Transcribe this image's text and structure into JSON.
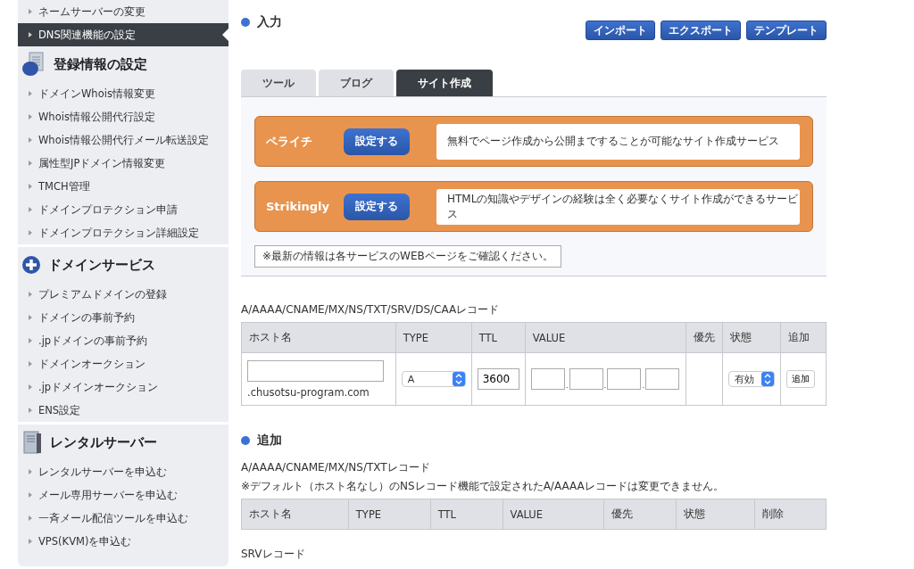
{
  "sidebar": {
    "items": [
      {
        "label": "ネームサーバーの変更",
        "selected": false
      },
      {
        "label": "DNS関連機能の設定",
        "selected": true
      }
    ],
    "sections": [
      {
        "kind": "records",
        "title": "登録情報の設定",
        "items": [
          {
            "label": "ドメインWhois情報変更",
            "selected": false
          },
          {
            "label": "Whois情報公開代行設定",
            "selected": false
          },
          {
            "label": "Whois情報公開代行メール転送設定",
            "selected": false
          },
          {
            "label": "属性型JPドメイン情報変更",
            "selected": false
          },
          {
            "label": "TMCH管理",
            "selected": false
          },
          {
            "label": "ドメインプロテクション申請",
            "selected": false
          },
          {
            "label": "ドメインプロテクション詳細設定",
            "selected": false
          }
        ]
      },
      {
        "kind": "service",
        "title": "ドメインサービス",
        "items": [
          {
            "label": "プレミアムドメインの登録",
            "selected": false
          },
          {
            "label": "ドメインの事前予約",
            "selected": false
          },
          {
            "label": ".jpドメインの事前予約",
            "selected": false
          },
          {
            "label": "ドメインオークション",
            "selected": false
          },
          {
            "label": ".jpドメインオークション",
            "selected": false
          },
          {
            "label": "ENS設定",
            "selected": false
          }
        ]
      },
      {
        "kind": "server",
        "title": "レンタルサーバー",
        "items": [
          {
            "label": "レンタルサーバーを申込む",
            "selected": false
          },
          {
            "label": "メール専用サーバーを申込む",
            "selected": false
          },
          {
            "label": "一斉メール配信ツールを申込む",
            "selected": false
          },
          {
            "label": "VPS(KVM)を申込む",
            "selected": false
          }
        ]
      }
    ]
  },
  "input": {
    "heading": "入力",
    "actions": [
      "インポート",
      "エクスポート",
      "テンプレート"
    ],
    "tabs": [
      {
        "label": "ツール",
        "selected": false
      },
      {
        "label": "ブログ",
        "selected": false
      },
      {
        "label": "サイト作成",
        "selected": true
      }
    ],
    "services": [
      {
        "name": "ペライチ",
        "button": "設定する",
        "description": "無料でページ作成から公開まですることが可能なサイト作成サービス"
      },
      {
        "name": "Strikingly",
        "button": "設定する",
        "description": "HTMLの知識やデザインの経験は全く必要なくサイト作成ができるサービス"
      }
    ],
    "note": "※最新の情報は各サービスのWEBページをご確認ください。"
  },
  "record_form": {
    "label": "A/AAAA/CNAME/MX/NS/TXT/SRV/DS/CAAレコード",
    "columns": [
      "ホスト名",
      "TYPE",
      "TTL",
      "VALUE",
      "優先",
      "状態",
      "追加"
    ],
    "row": {
      "host_suffix": ".chusotsu-program.com",
      "type": "A",
      "ttl": "3600",
      "value_separators": [
        ".",
        ".",
        "."
      ],
      "state": "有効",
      "add_button": "追加"
    }
  },
  "added": {
    "heading": "追加",
    "label": "A/AAAA/CNAME/MX/NS/TXTレコード",
    "note": "※デフォルト（ホスト名なし）のNSレコード機能で設定されたA/AAAAレコードは変更できません。",
    "columns": [
      "ホスト名",
      "TYPE",
      "TTL",
      "VALUE",
      "優先",
      "状態",
      "削除"
    ],
    "srv_label": "SRVレコード"
  }
}
